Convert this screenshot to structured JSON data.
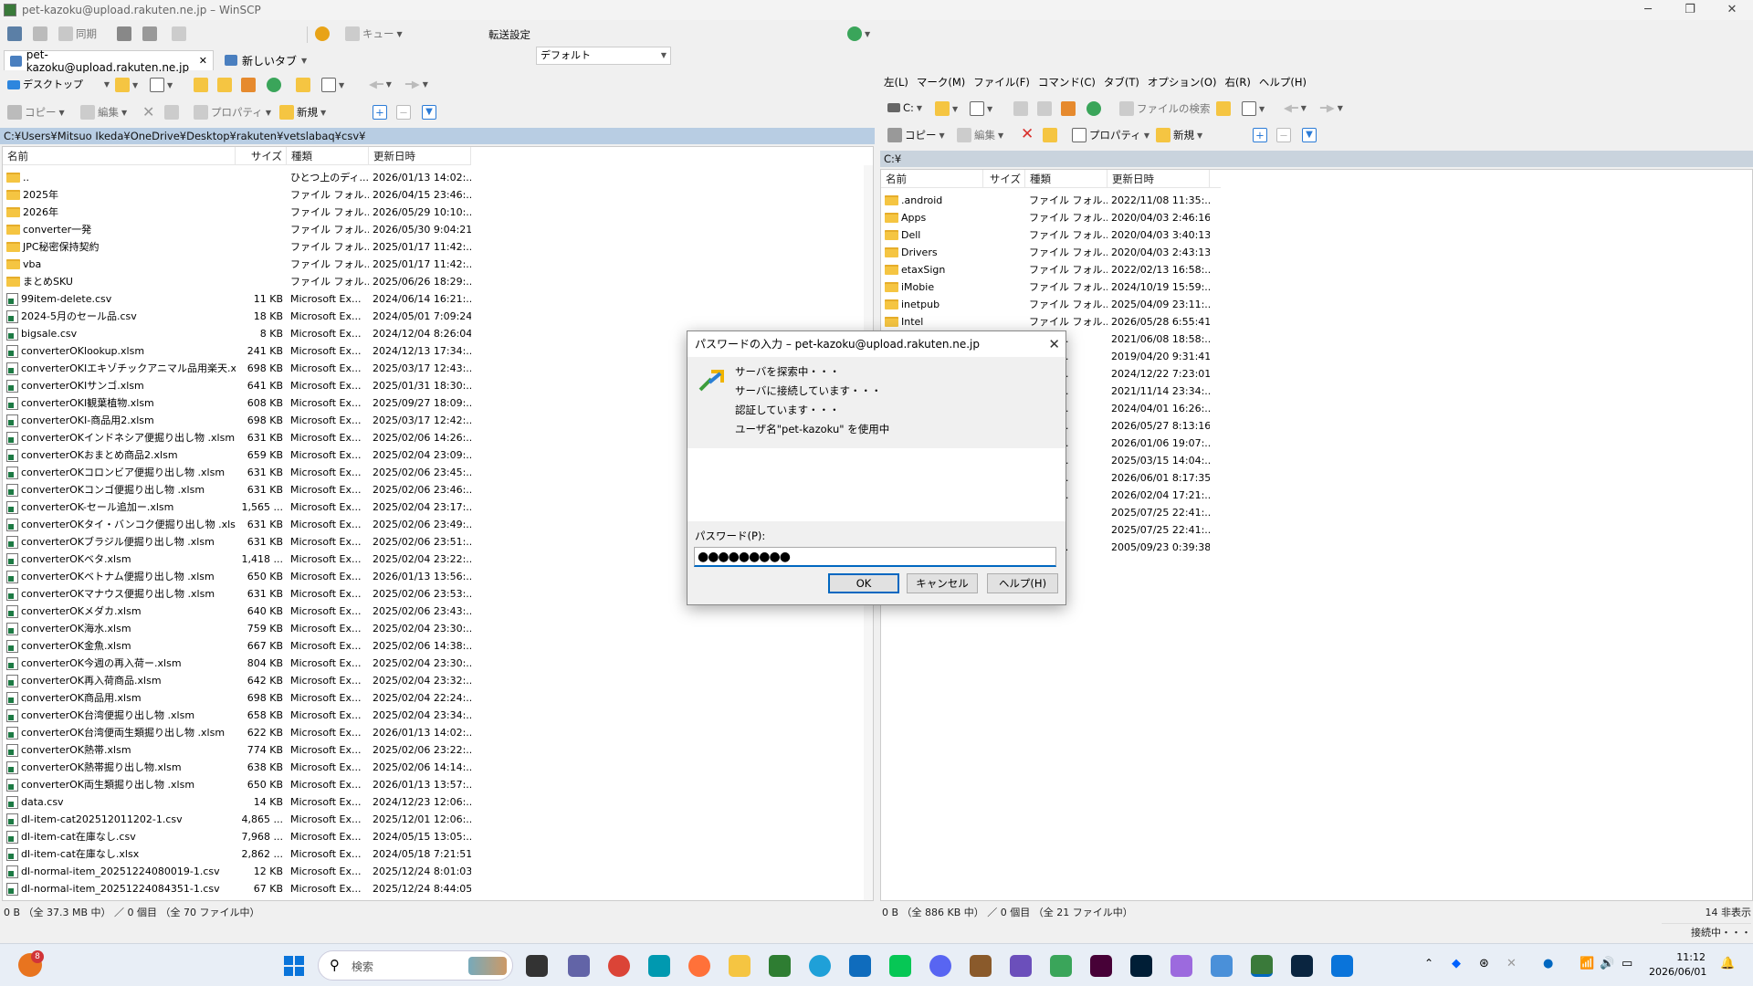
{
  "window": {
    "title": "pet-kazoku@upload.rakuten.ne.jp – WinSCP"
  },
  "toolbar": {
    "sync": "同期",
    "queue": "キュー",
    "transfer_label": "転送設定",
    "transfer_value": "デフォルト"
  },
  "tabs": [
    {
      "label": "pet-kazoku@upload.rakuten.ne.jp",
      "close": "✕"
    },
    {
      "label": "新しいタブ"
    }
  ],
  "left": {
    "drive": "デスクトップ",
    "copy": "コピー",
    "edit": "編集",
    "props": "プロパティ",
    "new": "新規",
    "path": "C:¥Users¥Mitsuo Ikeda¥OneDrive¥Desktop¥rakuten¥vetslabaq¥csv¥",
    "columns": [
      "名前",
      "サイズ",
      "種類",
      "更新日時"
    ],
    "rows": [
      {
        "t": "up",
        "name": "..",
        "size": "",
        "type": "ひとつ上のディ...",
        "date": "2026/01/13 14:02:..."
      },
      {
        "t": "folder",
        "name": "2025年",
        "size": "",
        "type": "ファイル フォル...",
        "date": "2026/04/15 23:46:..."
      },
      {
        "t": "folder",
        "name": "2026年",
        "size": "",
        "type": "ファイル フォル...",
        "date": "2026/05/29 10:10:..."
      },
      {
        "t": "folder",
        "name": "converter一発",
        "size": "",
        "type": "ファイル フォル...",
        "date": "2026/05/30 9:04:21"
      },
      {
        "t": "folder",
        "name": "JPC秘密保持契約",
        "size": "",
        "type": "ファイル フォル...",
        "date": "2025/01/17 11:42:..."
      },
      {
        "t": "folder",
        "name": "vba",
        "size": "",
        "type": "ファイル フォル...",
        "date": "2025/01/17 11:42:..."
      },
      {
        "t": "folder",
        "name": "まとめSKU",
        "size": "",
        "type": "ファイル フォル...",
        "date": "2025/06/26 18:29:..."
      },
      {
        "t": "file",
        "name": "99item-delete.csv",
        "size": "11 KB",
        "type": "Microsoft Ex...",
        "date": "2024/06/14 16:21:..."
      },
      {
        "t": "file",
        "name": "2024-5月のセール品.csv",
        "size": "18 KB",
        "type": "Microsoft Ex...",
        "date": "2024/05/01 7:09:24"
      },
      {
        "t": "file",
        "name": "bigsale.csv",
        "size": "8 KB",
        "type": "Microsoft Ex...",
        "date": "2024/12/04 8:26:04"
      },
      {
        "t": "file",
        "name": "converterOKlookup.xlsm",
        "size": "241 KB",
        "type": "Microsoft Ex...",
        "date": "2024/12/13 17:34:..."
      },
      {
        "t": "file",
        "name": "converterOKIエキゾチックアニマル品用楽天.xl...",
        "size": "698 KB",
        "type": "Microsoft Ex...",
        "date": "2025/03/17 12:43:..."
      },
      {
        "t": "file",
        "name": "converterOKIサンゴ.xlsm",
        "size": "641 KB",
        "type": "Microsoft Ex...",
        "date": "2025/01/31 18:30:..."
      },
      {
        "t": "file",
        "name": "converterOKI観葉植物.xlsm",
        "size": "608 KB",
        "type": "Microsoft Ex...",
        "date": "2025/09/27 18:09:..."
      },
      {
        "t": "file",
        "name": "converterOKI-商品用2.xlsm",
        "size": "698 KB",
        "type": "Microsoft Ex...",
        "date": "2025/03/17 12:42:..."
      },
      {
        "t": "file",
        "name": "converterOKインドネシア便掘り出し物 .xlsm",
        "size": "631 KB",
        "type": "Microsoft Ex...",
        "date": "2025/02/06 14:26:..."
      },
      {
        "t": "file",
        "name": "converterOKおまとめ商品2.xlsm",
        "size": "659 KB",
        "type": "Microsoft Ex...",
        "date": "2025/02/04 23:09:..."
      },
      {
        "t": "file",
        "name": "converterOKコロンビア便掘り出し物 .xlsm",
        "size": "631 KB",
        "type": "Microsoft Ex...",
        "date": "2025/02/06 23:45:..."
      },
      {
        "t": "file",
        "name": "converterOKコンゴ便掘り出し物 .xlsm",
        "size": "631 KB",
        "type": "Microsoft Ex...",
        "date": "2025/02/06 23:46:..."
      },
      {
        "t": "file",
        "name": "converterOK-セール追加ー.xlsm",
        "size": "1,565 ...",
        "type": "Microsoft Ex...",
        "date": "2025/02/04 23:17:..."
      },
      {
        "t": "file",
        "name": "converterOKタイ・バンコク便掘り出し物 .xlsm",
        "size": "631 KB",
        "type": "Microsoft Ex...",
        "date": "2025/02/06 23:49:..."
      },
      {
        "t": "file",
        "name": "converterOKブラジル便掘り出し物 .xlsm",
        "size": "631 KB",
        "type": "Microsoft Ex...",
        "date": "2025/02/06 23:51:..."
      },
      {
        "t": "file",
        "name": "converterOKベタ.xlsm",
        "size": "1,418 ...",
        "type": "Microsoft Ex...",
        "date": "2025/02/04 23:22:..."
      },
      {
        "t": "file",
        "name": "converterOKベトナム便掘り出し物 .xlsm",
        "size": "650 KB",
        "type": "Microsoft Ex...",
        "date": "2026/01/13 13:56:..."
      },
      {
        "t": "file",
        "name": "converterOKマナウス便掘り出し物 .xlsm",
        "size": "631 KB",
        "type": "Microsoft Ex...",
        "date": "2025/02/06 23:53:..."
      },
      {
        "t": "file",
        "name": "converterOKメダカ.xlsm",
        "size": "640 KB",
        "type": "Microsoft Ex...",
        "date": "2025/02/06 23:43:..."
      },
      {
        "t": "file",
        "name": "converterOK海水.xlsm",
        "size": "759 KB",
        "type": "Microsoft Ex...",
        "date": "2025/02/04 23:30:..."
      },
      {
        "t": "file",
        "name": "converterOK金魚.xlsm",
        "size": "667 KB",
        "type": "Microsoft Ex...",
        "date": "2025/02/06 14:38:..."
      },
      {
        "t": "file",
        "name": "converterOK今週の再入荷ー.xlsm",
        "size": "804 KB",
        "type": "Microsoft Ex...",
        "date": "2025/02/04 23:30:..."
      },
      {
        "t": "file",
        "name": "converterOK再入荷商品.xlsm",
        "size": "642 KB",
        "type": "Microsoft Ex...",
        "date": "2025/02/04 23:32:..."
      },
      {
        "t": "file",
        "name": "converterOK商品用.xlsm",
        "size": "698 KB",
        "type": "Microsoft Ex...",
        "date": "2025/02/04 22:24:..."
      },
      {
        "t": "file",
        "name": "converterOK台湾便掘り出し物 .xlsm",
        "size": "658 KB",
        "type": "Microsoft Ex...",
        "date": "2025/02/04 23:34:..."
      },
      {
        "t": "file",
        "name": "converterOK台湾便両生類掘り出し物 .xlsm",
        "size": "622 KB",
        "type": "Microsoft Ex...",
        "date": "2026/01/13 14:02:..."
      },
      {
        "t": "file",
        "name": "converterOK熱帯.xlsm",
        "size": "774 KB",
        "type": "Microsoft Ex...",
        "date": "2025/02/06 23:22:..."
      },
      {
        "t": "file",
        "name": "converterOK熱帯掘り出し物.xlsm",
        "size": "638 KB",
        "type": "Microsoft Ex...",
        "date": "2025/02/06 14:14:..."
      },
      {
        "t": "file",
        "name": "converterOK両生類掘り出し物 .xlsm",
        "size": "650 KB",
        "type": "Microsoft Ex...",
        "date": "2026/01/13 13:57:..."
      },
      {
        "t": "file",
        "name": "data.csv",
        "size": "14 KB",
        "type": "Microsoft Ex...",
        "date": "2024/12/23 12:06:..."
      },
      {
        "t": "file",
        "name": "dl-item-cat202512011202-1.csv",
        "size": "4,865 ...",
        "type": "Microsoft Ex...",
        "date": "2025/12/01 12:06:..."
      },
      {
        "t": "file",
        "name": "dl-item-cat在庫なし.csv",
        "size": "7,968 ...",
        "type": "Microsoft Ex...",
        "date": "2024/05/15 13:05:..."
      },
      {
        "t": "file",
        "name": "dl-item-cat在庫なし.xlsx",
        "size": "2,862 ...",
        "type": "Microsoft Ex...",
        "date": "2024/05/18 7:21:51"
      },
      {
        "t": "file",
        "name": "dl-normal-item_20251224080019-1.csv",
        "size": "12 KB",
        "type": "Microsoft Ex...",
        "date": "2025/12/24 8:01:03"
      },
      {
        "t": "file",
        "name": "dl-normal-item_20251224084351-1.csv",
        "size": "67 KB",
        "type": "Microsoft Ex...",
        "date": "2025/12/24 8:44:05"
      }
    ],
    "status": "0 B （全 37.3 MB 中） ／ 0 個目 （全 70 ファイル中）"
  },
  "right": {
    "menu": [
      "左(L)",
      "マーク(M)",
      "ファイル(F)",
      "コマンド(C)",
      "タブ(T)",
      "オプション(O)",
      "右(R)",
      "ヘルプ(H)"
    ],
    "drive": "C:",
    "find": "ファイルの検索",
    "copy": "コピー",
    "edit": "編集",
    "props": "プロパティ",
    "new": "新規",
    "path": "C:¥",
    "columns": [
      "名前",
      "サイズ",
      "種類",
      "更新日時"
    ],
    "rows": [
      {
        "t": "folder",
        "name": ".android",
        "type": "ファイル フォル...",
        "date": "2022/11/08 11:35:..."
      },
      {
        "t": "folder",
        "name": "Apps",
        "type": "ファイル フォル...",
        "date": "2020/04/03 2:46:16"
      },
      {
        "t": "folder",
        "name": "Dell",
        "type": "ファイル フォル...",
        "date": "2020/04/03 3:40:13"
      },
      {
        "t": "folder",
        "name": "Drivers",
        "type": "ファイル フォル...",
        "date": "2020/04/03 2:43:13"
      },
      {
        "t": "folder",
        "name": "etaxSign",
        "type": "ファイル フォル...",
        "date": "2022/02/13 16:58:..."
      },
      {
        "t": "folder",
        "name": "iMobie",
        "type": "ファイル フォル...",
        "date": "2024/10/19 15:59:..."
      },
      {
        "t": "folder",
        "name": "inetpub",
        "type": "ファイル フォル...",
        "date": "2025/04/09 23:11:..."
      },
      {
        "t": "folder",
        "name": "Intel",
        "type": "ファイル フォル...",
        "date": "2026/05/28 6:55:41"
      },
      {
        "t": "folder",
        "name": "",
        "type": "フォル...",
        "date": "2021/06/08 18:58:..."
      },
      {
        "t": "folder",
        "name": "",
        "type": "フォル...",
        "date": "2019/04/20 9:31:41"
      },
      {
        "t": "folder",
        "name": "",
        "type": "フォル...",
        "date": "2024/12/22 7:23:01"
      },
      {
        "t": "folder",
        "name": "",
        "type": "フォル...",
        "date": "2021/11/14 23:34:..."
      },
      {
        "t": "folder",
        "name": "",
        "type": "フォル...",
        "date": "2024/04/01 16:26:..."
      },
      {
        "t": "folder",
        "name": "",
        "type": "フォル...",
        "date": "2026/05/27 8:13:16"
      },
      {
        "t": "folder",
        "name": "",
        "type": "フォル...",
        "date": "2026/01/06 19:07:..."
      },
      {
        "t": "folder",
        "name": "",
        "type": "フォル...",
        "date": "2025/03/15 14:04:..."
      },
      {
        "t": "folder",
        "name": "",
        "type": "フォル...",
        "date": "2026/06/01 8:17:35"
      },
      {
        "t": "folder",
        "name": "",
        "type": "ドキュ...",
        "date": "2026/02/04 17:21:..."
      },
      {
        "t": "file",
        "name": "",
        "type": "定",
        "date": "2025/07/25 22:41:..."
      },
      {
        "t": "file",
        "name": "",
        "type": "定",
        "date": "2025/07/25 22:41:..."
      },
      {
        "t": "file",
        "name": "",
        "type": "ーショ...",
        "date": "2005/09/23 0:39:38"
      }
    ],
    "status": "0 B （全 886 KB 中） ／ 0 個目 （全 21 ファイル中）",
    "hidden": "14 非表示"
  },
  "bottom_status": "接続中・・・",
  "dialog": {
    "title": "パスワードの入力 – pet-kazoku@upload.rakuten.ne.jp",
    "lines": [
      "サーバを探索中・・・",
      "サーバに接続しています・・・",
      "認証しています・・・",
      "ユーザ名\"pet-kazoku\" を使用中"
    ],
    "label": "パスワード(P):",
    "password": "●●●●●●●●●",
    "ok": "OK",
    "cancel": "キャンセル",
    "help": "ヘルプ(H)"
  },
  "taskbar": {
    "search": "検索",
    "badge": "8",
    "time": "11:12",
    "date": "2026/06/01"
  }
}
